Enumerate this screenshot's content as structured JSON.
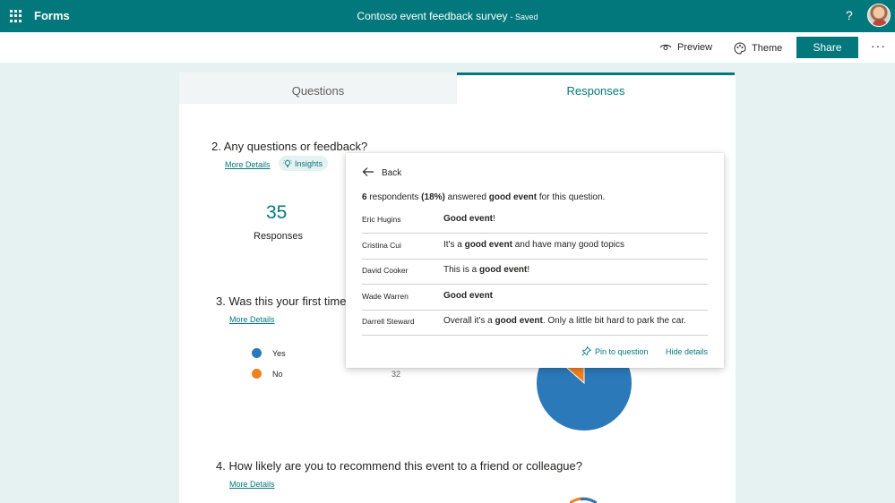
{
  "header": {
    "app_name": "Forms",
    "doc_title": "Contoso event feedback survey",
    "saved_status": "- Saved",
    "help": "?",
    "icons": {
      "waffle": "app-launcher-icon",
      "avatar": "user-avatar"
    }
  },
  "toolbar": {
    "preview_label": "Preview",
    "theme_label": "Theme",
    "share_label": "Share",
    "more_label": "···"
  },
  "tabs": [
    {
      "label": "Questions",
      "active": false
    },
    {
      "label": "Responses",
      "active": true
    }
  ],
  "questions": [
    {
      "title": "2. Any questions or feedback?",
      "more_details": "More Details",
      "insights_label": "Insights",
      "response_count": "35",
      "response_label": "Responses"
    },
    {
      "title": "3. Was this your first time",
      "more_details": "More Details",
      "legend": [
        {
          "label": "Yes",
          "count": "",
          "color": "#2b79b8"
        },
        {
          "label": "No",
          "count": "32",
          "color": "#f0801f"
        }
      ]
    },
    {
      "title": "4. How likely are you to recommend this event to a friend or colleague?",
      "more_details": "More Details"
    }
  ],
  "insights_panel": {
    "back_label": "Back",
    "summary": {
      "count": "6",
      "text_1": " respondents ",
      "percent": "(18%)",
      "text_2": " answered ",
      "keyword": "good event",
      "text_3": " for this question."
    },
    "responses": [
      {
        "name": "Eric Hugins",
        "pre": "",
        "bold": "Good event",
        "post": "!"
      },
      {
        "name": "Cristina Cui",
        "pre": "It's a ",
        "bold": "good event",
        "post": " and have many good topics"
      },
      {
        "name": "David Cooker",
        "pre": "This is a ",
        "bold": "good event",
        "post": "!"
      },
      {
        "name": "Wade Warren",
        "pre": "",
        "bold": "Good event",
        "post": ""
      },
      {
        "name": "Darrell Steward",
        "pre": "Overall it's a ",
        "bold": "good event",
        "post": ". Only a little bit hard to park the car."
      }
    ],
    "pin_label": "Pin to question",
    "hide_label": "Hide details"
  },
  "colors": {
    "accent": "#03787c",
    "yes": "#2b79b8",
    "no": "#f0801f"
  }
}
